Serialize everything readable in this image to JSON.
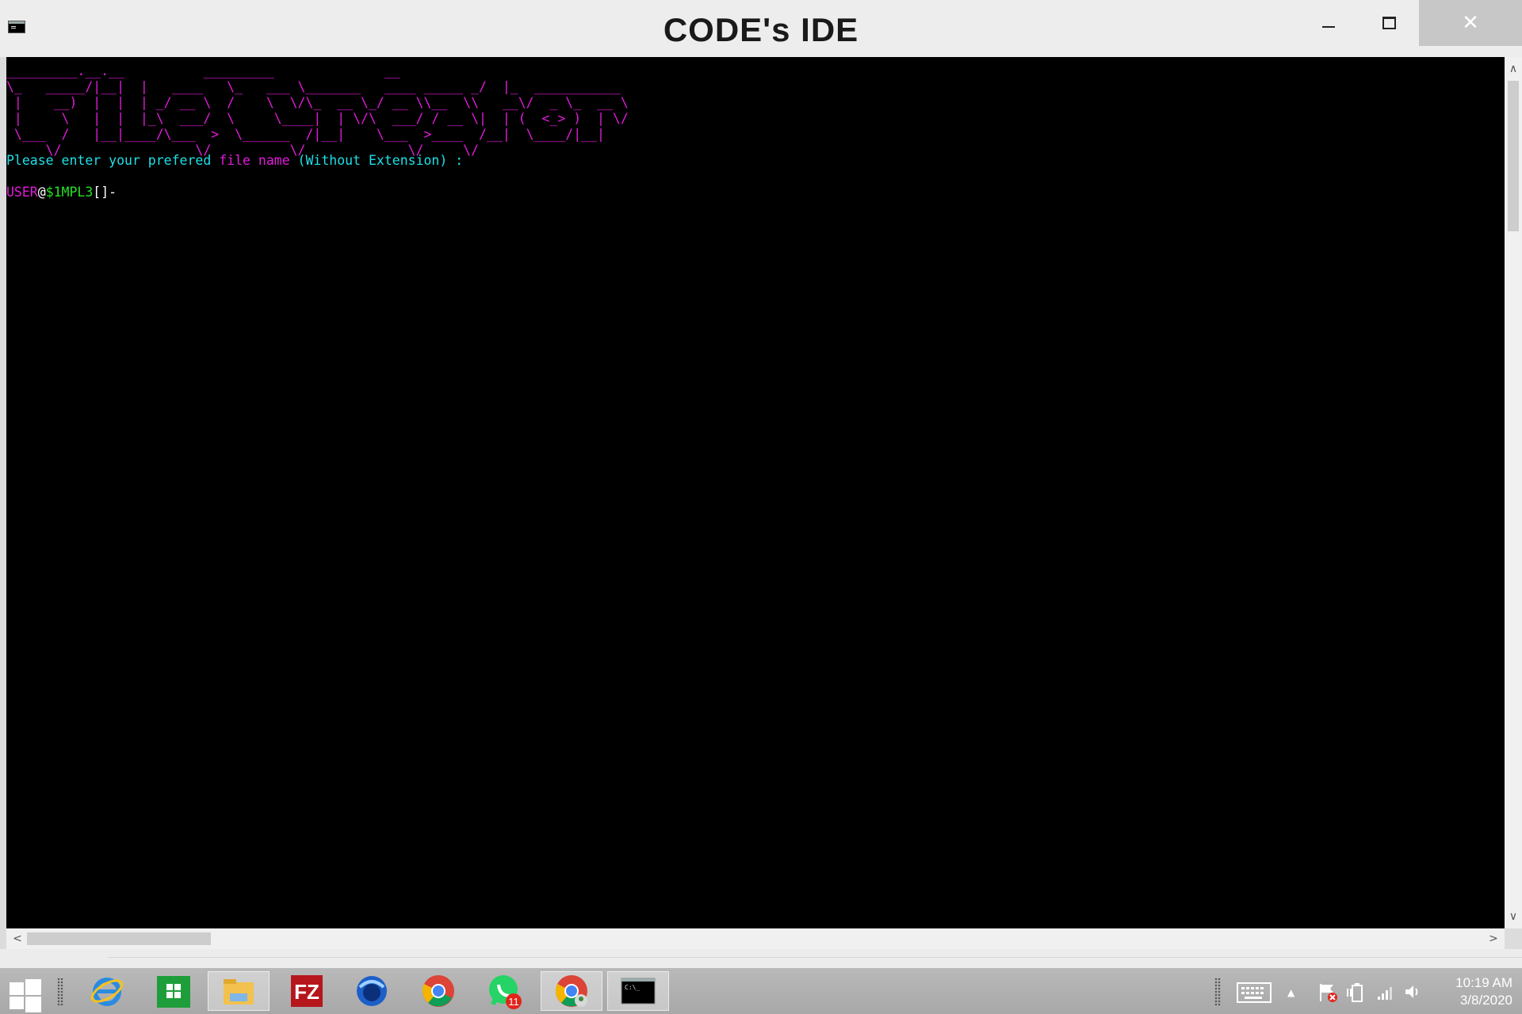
{
  "window": {
    "title": "CODE's IDE",
    "controls": {
      "minimize": "minimize",
      "maximize": "maximize",
      "close": "✕"
    }
  },
  "console": {
    "banner_lines": [
      "_________.__.__          _________              __",
      "\\_   _____/|__|  |   ____   \\_   ___ \\_______   ____ _____ _/  |_  ___________",
      " |    __)  |  |  | _/ __ \\  /    \\  \\/\\_  __ \\_/ __ \\\\__  \\\\   __\\/  _ \\_  __ \\",
      " |     \\   |  |  |_\\  ___/  \\     \\____|  | \\/\\  ___/ / __ \\|  | (  <_> )  | \\/",
      " \\___  /   |__|____/\\___  >  \\______  /|__|    \\___  >____  /__|  \\____/|__|",
      "     \\/                 \\/          \\/             \\/     \\/"
    ],
    "prompt": {
      "part1": "Please enter your prefered ",
      "part2": "file name",
      "part3": " (Without Extension) :"
    },
    "input": {
      "user": "USER",
      "at": "@",
      "host": "$1MPL3",
      "tail": "[]-"
    }
  },
  "scrollbars": {
    "up": "∧",
    "down": "∨",
    "left": "<",
    "right": ">"
  },
  "taskbar": {
    "icons": [
      "windows-start-icon",
      "internet-explorer-icon",
      "store-icon",
      "file-explorer-icon",
      "filezilla-icon",
      "thunderbird-icon",
      "chrome-icon",
      "whatsapp-icon",
      "chrome-user-icon",
      "command-prompt-icon"
    ],
    "whatsapp_badge": "11",
    "time": "10:19 AM",
    "date": "3/8/2020"
  },
  "colors": {
    "banner": "#e01bd9",
    "prompt_text": "#1ee0e8",
    "host": "#27e026"
  }
}
